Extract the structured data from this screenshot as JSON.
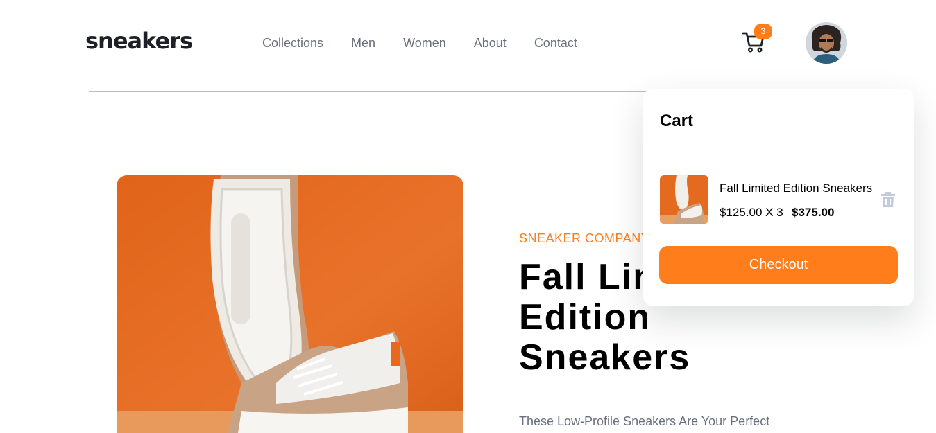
{
  "header": {
    "logo": "sneakers",
    "nav": [
      "Collections",
      "Men",
      "Women",
      "About",
      "Contact"
    ],
    "cart_count": "3",
    "cart_icon": "cart-icon",
    "avatar": "user-avatar"
  },
  "product": {
    "company": "SNEAKER COMPANY",
    "title": "Fall Limited Edition Sneakers",
    "description": "These Low-Profile Sneakers Are Your Perfect"
  },
  "cart": {
    "heading": "Cart",
    "item_name": "Fall Limited Edition Sneakers",
    "item_price": "$125.00 X 3",
    "item_total": "$375.00",
    "delete_icon": "trash-icon",
    "checkout_label": "Checkout"
  },
  "colors": {
    "accent": "#ff7e1b",
    "text_dark": "#1d2026",
    "text_grey": "#69707d",
    "product_bg": "#e86c1f"
  }
}
